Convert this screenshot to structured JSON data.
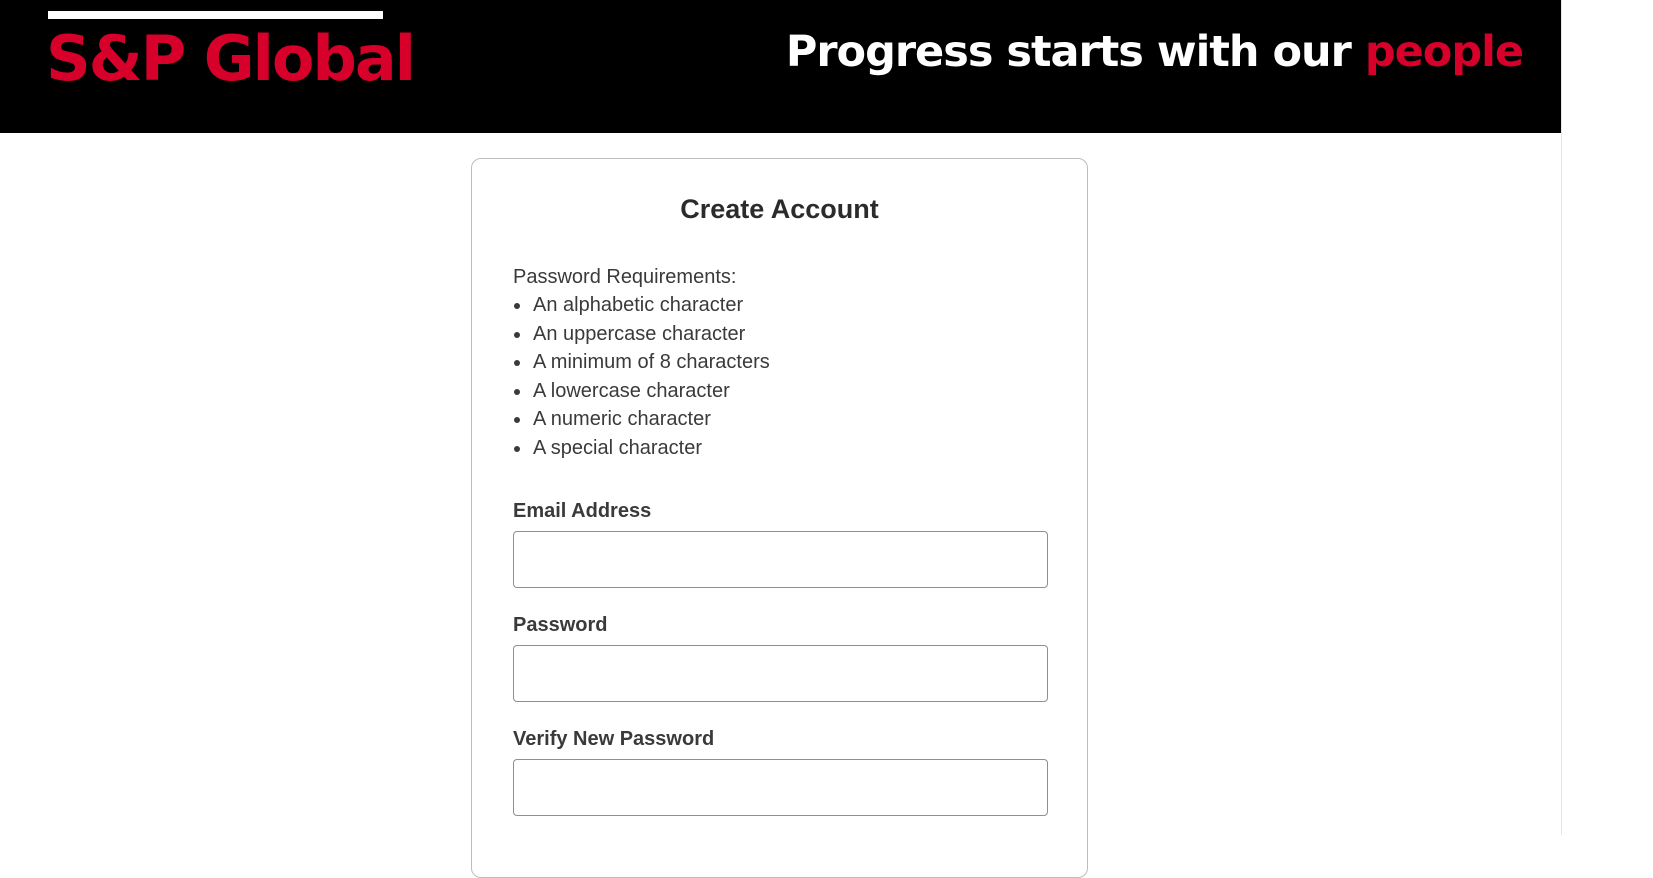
{
  "header": {
    "logo_text": "S&P Global",
    "tagline_main": "Progress starts with our",
    "tagline_accent": "people",
    "colors": {
      "background": "#000000",
      "brand_red": "#d6002a",
      "tagline_text": "#ffffff"
    }
  },
  "form": {
    "title": "Create Account",
    "requirements": {
      "heading": "Password Requirements:",
      "items": [
        "An alphabetic character",
        "An uppercase character",
        "A minimum of 8 characters",
        "A lowercase character",
        "A numeric character",
        "A special character"
      ]
    },
    "fields": {
      "email": {
        "label": "Email Address",
        "value": "",
        "placeholder": ""
      },
      "password": {
        "label": "Password",
        "value": "",
        "placeholder": ""
      },
      "verify_password": {
        "label": "Verify New Password",
        "value": "",
        "placeholder": ""
      }
    }
  }
}
